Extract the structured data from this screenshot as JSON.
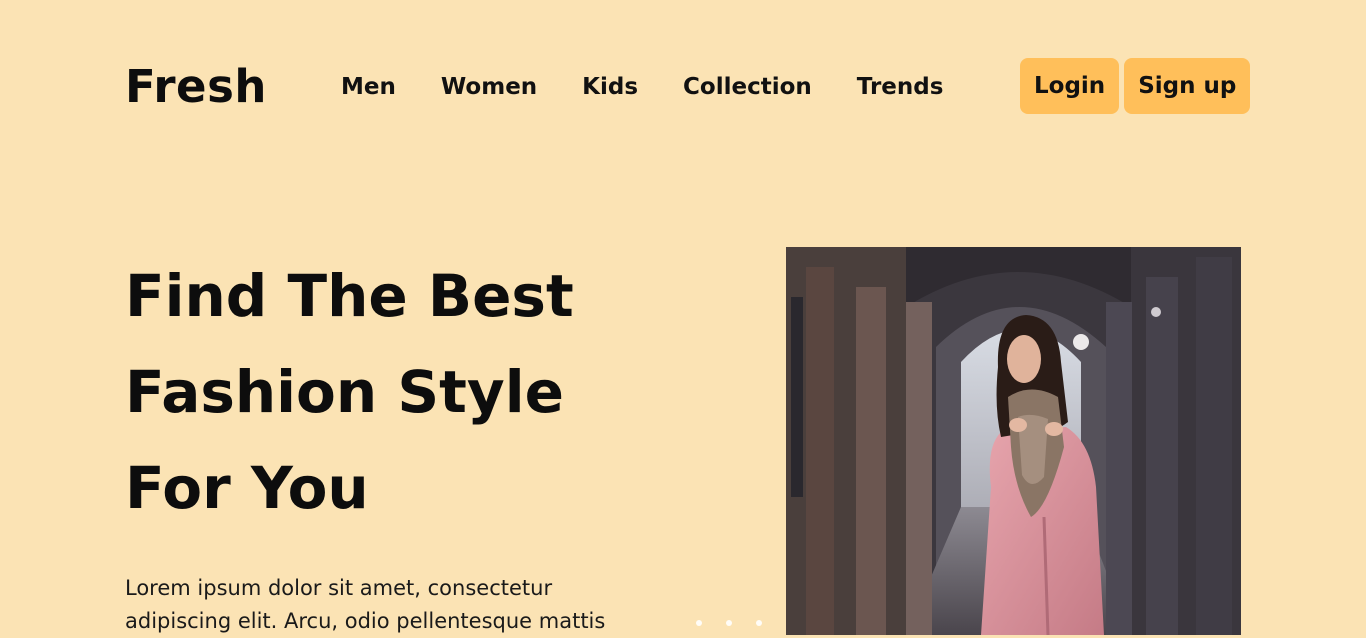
{
  "brand": {
    "logo_text": "Fresh"
  },
  "nav": {
    "items": [
      {
        "label": "Men"
      },
      {
        "label": "Women"
      },
      {
        "label": "Kids"
      },
      {
        "label": "Collection"
      },
      {
        "label": "Trends"
      }
    ]
  },
  "auth": {
    "login_label": "Login",
    "signup_label": "Sign up"
  },
  "hero": {
    "title_lines": [
      "Find The Best",
      "Fashion Style",
      "For You"
    ],
    "text_lines": [
      "Lorem ipsum dolor sit amet, consectetur",
      "adipiscing elit. Arcu, odio pellentesque mattis"
    ],
    "slider": {
      "dot_count": 3
    }
  },
  "colors": {
    "background": "#fbe3b4",
    "button": "#ffbf5a",
    "text": "#111111"
  }
}
